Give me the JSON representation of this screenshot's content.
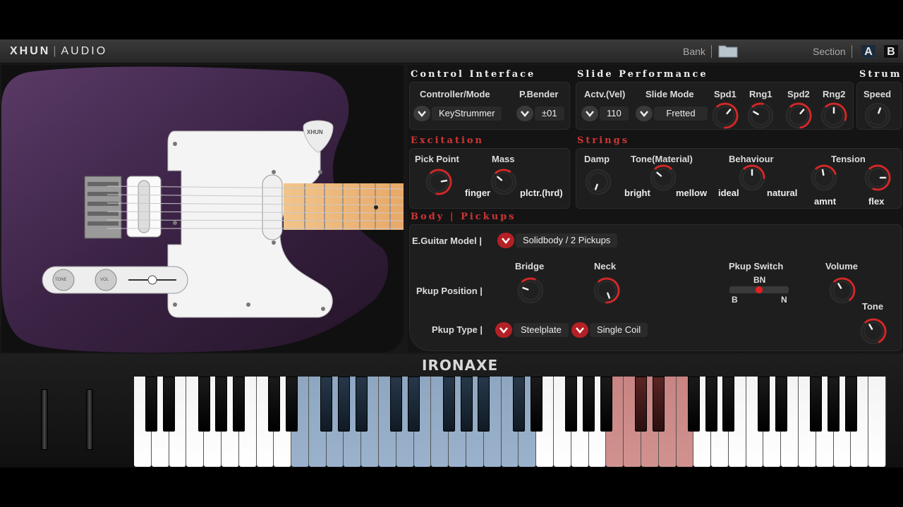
{
  "header": {
    "brand_name": "XHUN",
    "brand_sub": "AUDIO",
    "bank_label": "Bank",
    "section_label": "Section",
    "ab_a": "A",
    "ab_b": "B"
  },
  "guitar": {
    "pick_logo": "XHUN",
    "knob_tone": "TONE",
    "knob_vol": "VOL"
  },
  "control_interface": {
    "title": "Control Interface",
    "controller_label": "Controller/Mode",
    "controller_value": "KeyStrummer",
    "pbender_label": "P.Bender",
    "pbender_value": "±01"
  },
  "slide_performance": {
    "title": "Slide Performance",
    "actv_label": "Actv.(Vel)",
    "actv_value": "110",
    "slide_mode_label": "Slide Mode",
    "slide_mode_value": "Fretted",
    "spd1": "Spd1",
    "rng1": "Rng1",
    "spd2": "Spd2",
    "rng2": "Rng2"
  },
  "strum": {
    "title": "Strum",
    "speed_label": "Speed"
  },
  "excitation": {
    "title": "Excitation",
    "pick_point": "Pick Point",
    "mass": "Mass",
    "finger": "finger",
    "plctr": "plctr.(hrd)"
  },
  "strings": {
    "title": "Strings",
    "damp": "Damp",
    "tone": "Tone(Material)",
    "bright": "bright",
    "mellow": "mellow",
    "behaviour": "Behaviour",
    "ideal": "ideal",
    "natural": "natural",
    "tension": "Tension",
    "amnt": "amnt",
    "flex": "flex"
  },
  "body_pickups": {
    "title_body": "Body",
    "title_pickups": "Pickups",
    "model_label": "E.Guitar Model |",
    "model_value": "Solidbody / 2 Pickups",
    "position_label": "Pkup Position |",
    "bridge": "Bridge",
    "neck": "Neck",
    "type_label": "Pkup Type |",
    "type1": "Steelplate",
    "type2": "Single Coil",
    "switch_label": "Pkup Switch",
    "switch_value": "BN",
    "switch_b": "B",
    "switch_n": "N",
    "volume": "Volume",
    "tone": "Tone"
  },
  "keyboard": {
    "product_name": "IRONAXE"
  },
  "colors": {
    "accent_red": "#d03535",
    "keyswitch_blue": "#9ab2cc",
    "keyrange_red": "#d1928f"
  }
}
